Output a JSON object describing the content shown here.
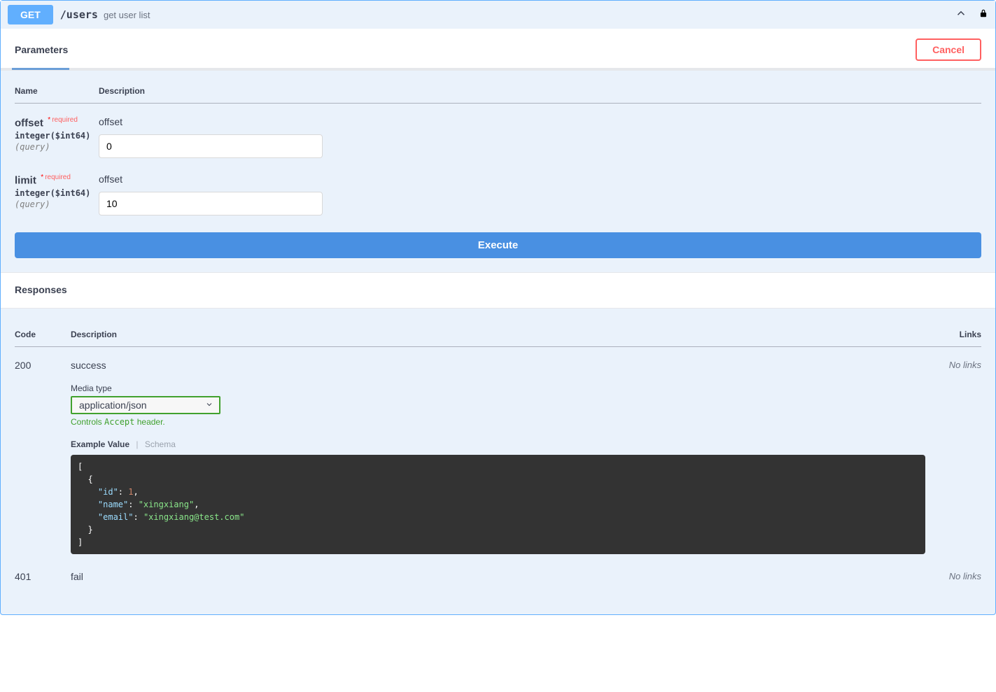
{
  "operation": {
    "method": "GET",
    "path": "/users",
    "summary": "get user list"
  },
  "sections": {
    "parameters_title": "Parameters",
    "responses_title": "Responses",
    "cancel_label": "Cancel",
    "execute_label": "Execute"
  },
  "param_headers": {
    "name": "Name",
    "description": "Description"
  },
  "required_label": "required",
  "parameters": [
    {
      "name": "offset",
      "type": "integer($int64)",
      "in": "(query)",
      "description": "offset",
      "value": "0"
    },
    {
      "name": "limit",
      "type": "integer($int64)",
      "in": "(query)",
      "description": "offset",
      "value": "10"
    }
  ],
  "response_headers": {
    "code": "Code",
    "description": "Description",
    "links": "Links"
  },
  "media_type_label": "Media type",
  "media_type_selected": "application/json",
  "controls_hint_prefix": "Controls ",
  "controls_hint_accept": "Accept",
  "controls_hint_suffix": " header.",
  "example_tabs": {
    "example_value": "Example Value",
    "schema": "Schema"
  },
  "no_links": "No links",
  "responses": [
    {
      "code": "200",
      "description": "success",
      "has_example": true,
      "example_tokens": [
        {
          "text": "[",
          "cls": "tok-br"
        },
        {
          "nl": true
        },
        {
          "text": "  {",
          "cls": "tok-br"
        },
        {
          "nl": true
        },
        {
          "text": "    \"id\"",
          "cls": "tok-key"
        },
        {
          "text": ": ",
          "cls": "tok-p"
        },
        {
          "text": "1",
          "cls": "tok-num"
        },
        {
          "text": ",",
          "cls": "tok-p"
        },
        {
          "nl": true
        },
        {
          "text": "    \"name\"",
          "cls": "tok-key"
        },
        {
          "text": ": ",
          "cls": "tok-p"
        },
        {
          "text": "\"xingxiang\"",
          "cls": "tok-str"
        },
        {
          "text": ",",
          "cls": "tok-p"
        },
        {
          "nl": true
        },
        {
          "text": "    \"email\"",
          "cls": "tok-key"
        },
        {
          "text": ": ",
          "cls": "tok-p"
        },
        {
          "text": "\"xingxiang@test.com\"",
          "cls": "tok-str"
        },
        {
          "nl": true
        },
        {
          "text": "  }",
          "cls": "tok-br"
        },
        {
          "nl": true
        },
        {
          "text": "]",
          "cls": "tok-br"
        }
      ],
      "links": "No links"
    },
    {
      "code": "401",
      "description": "fail",
      "has_example": false,
      "links": "No links"
    }
  ]
}
